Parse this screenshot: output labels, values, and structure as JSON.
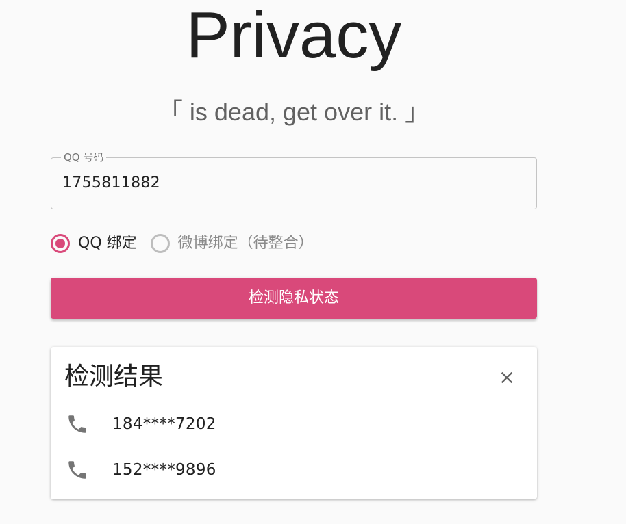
{
  "header": {
    "title": "Privacy",
    "subtitle": "「 is dead, get over it. 」"
  },
  "qq_field": {
    "label": "QQ 号码",
    "value": "1755811882"
  },
  "binding_options": [
    {
      "label": "QQ 绑定",
      "selected": true
    },
    {
      "label": "微博绑定（待整合）",
      "selected": false
    }
  ],
  "check_button": {
    "label": "检测隐私状态"
  },
  "result_card": {
    "title": "检测结果",
    "close_icon": "close-icon",
    "items": [
      {
        "icon": "phone-icon",
        "text": "184****7202"
      },
      {
        "icon": "phone-icon",
        "text": "152****9896"
      }
    ]
  },
  "colors": {
    "accent": "#d9497a",
    "background": "#fafafa",
    "icon_gray": "#757575"
  }
}
